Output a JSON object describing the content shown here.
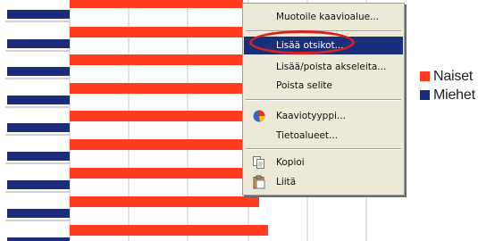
{
  "chart_data": {
    "type": "bar",
    "orientation": "horizontal",
    "series": [
      {
        "name": "Naiset",
        "color": "#ff3c1f"
      },
      {
        "name": "Miehet",
        "color": "#1c2c78"
      }
    ],
    "legend_position": "right",
    "grid": true
  },
  "legend": {
    "items": [
      {
        "label": "Naiset",
        "color": "#ff3c1f"
      },
      {
        "label": "Miehet",
        "color": "#1c2c78"
      }
    ]
  },
  "context_menu": {
    "items": [
      {
        "label": "Muotoile kaavioalue...",
        "icon": ""
      },
      {
        "label": "Lisää otsikot...",
        "icon": "",
        "highlighted": true
      },
      {
        "label": "Lisää/poista akseleita...",
        "icon": ""
      },
      {
        "label": "Poista selite",
        "icon": ""
      },
      {
        "label": "Kaaviotyyppi...",
        "icon": "chart-type-icon"
      },
      {
        "label": "Tietoalueet...",
        "icon": ""
      },
      {
        "label": "Kopioi",
        "icon": "copy-icon"
      },
      {
        "label": "Liitä",
        "icon": "paste-icon"
      }
    ]
  },
  "colors": {
    "accent_highlight": "#1a2f7c",
    "annotation": "#d8231d",
    "menu_background": "#ece9d8"
  }
}
